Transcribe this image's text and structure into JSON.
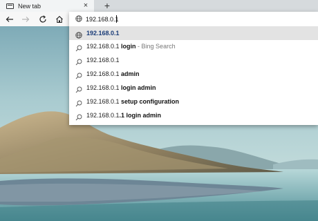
{
  "tab": {
    "title": "New tab",
    "close_glyph": "×",
    "new_tab_glyph": "+"
  },
  "toolbar": {
    "back_icon": "back-arrow-icon",
    "forward_icon": "forward-arrow-icon",
    "refresh_icon": "refresh-icon",
    "home_icon": "home-icon"
  },
  "address": {
    "value": "192.168.0.1",
    "icon": "globe-icon"
  },
  "suggestions": [
    {
      "icon": "globe-icon",
      "text": "192.168.0.1",
      "bold": "",
      "suffix": "",
      "selected": true
    },
    {
      "icon": "search-icon",
      "text": "192.168.0.1 ",
      "bold": "login",
      "suffix": " - Bing Search",
      "selected": false
    },
    {
      "icon": "search-icon",
      "text": "192.168.0.1",
      "bold": "",
      "suffix": "",
      "selected": false
    },
    {
      "icon": "search-icon",
      "text": "192.168.0.1 ",
      "bold": "admin",
      "suffix": "",
      "selected": false
    },
    {
      "icon": "search-icon",
      "text": "192.168.0.1 ",
      "bold": "login admin",
      "suffix": "",
      "selected": false
    },
    {
      "icon": "search-icon",
      "text": "192.168.0.1 ",
      "bold": "setup configuration",
      "suffix": "",
      "selected": false
    },
    {
      "icon": "search-icon",
      "text": "192.168.0.1",
      "bold": ".1 login admin",
      "suffix": "",
      "selected": false
    }
  ],
  "colors": {
    "selected_link": "#1a3c78",
    "selection_bg": "#e3e3e3"
  }
}
